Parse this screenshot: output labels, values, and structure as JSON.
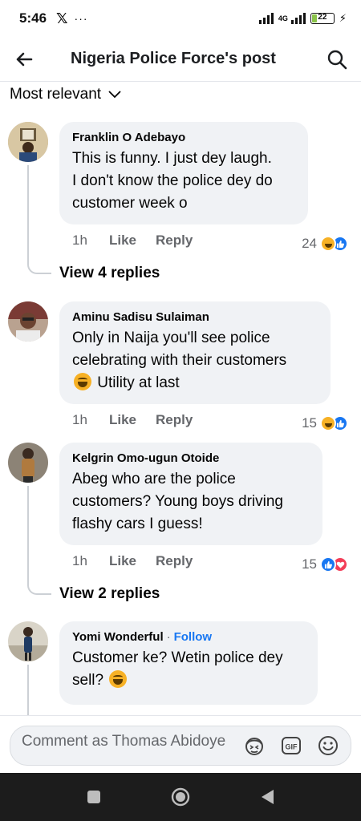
{
  "status_bar": {
    "time": "5:46",
    "x_logo": "𝕏",
    "more": "···",
    "network": "4G",
    "battery": "22",
    "battery_level": 0.22
  },
  "header": {
    "title": "Nigeria Police Force's post"
  },
  "sort": {
    "label": "Most relevant"
  },
  "comments": [
    {
      "author": "Franklin O Adebayo",
      "lines": [
        "This is funny. I just dey laugh.",
        "I don't know the police dey do",
        "customer week o"
      ],
      "time": "1h",
      "like": "Like",
      "reply": "Reply",
      "reaction_count": "24",
      "view_replies": "View 4 replies"
    },
    {
      "author": "Aminu Sadisu Sulaiman",
      "lines": [
        "Only in Naija you'll see police",
        "celebrating with their customers",
        "Utility at last"
      ],
      "time": "1h",
      "like": "Like",
      "reply": "Reply",
      "reaction_count": "15"
    },
    {
      "author": "Kelgrin Omo-ugun Otoide",
      "lines": [
        "Abeg who are the police",
        "customers? Young boys driving",
        "flashy cars I guess!"
      ],
      "time": "1h",
      "like": "Like",
      "reply": "Reply",
      "reaction_count": "15",
      "view_replies": "View 2 replies"
    },
    {
      "author": "Yomi Wonderful",
      "follow": "Follow",
      "lines": [
        "Customer ke? Wetin police dey",
        "sell?"
      ]
    }
  ],
  "composer": {
    "placeholder": "Comment as Thomas Abidoye"
  },
  "colors": {
    "accent": "#1877f2",
    "bubble": "#f0f2f5",
    "muted": "#65676b"
  }
}
